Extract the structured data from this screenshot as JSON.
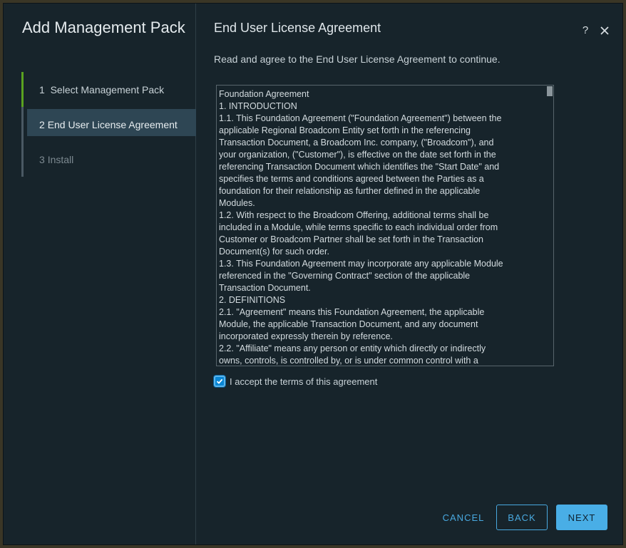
{
  "sidebar": {
    "title": "Add Management Pack",
    "steps": [
      {
        "number": "1",
        "label": "Select Management Pack",
        "state": "done"
      },
      {
        "number": "2",
        "label": "End User License Agreement",
        "state": "active"
      },
      {
        "number": "3",
        "label": "Install",
        "state": "pending"
      }
    ]
  },
  "header": {
    "title": "End User License Agreement",
    "help_icon": "?",
    "close_icon": "close-icon"
  },
  "intro": "Read and agree to the End User License Agreement to continue.",
  "eula": {
    "lines": [
      "Foundation Agreement",
      "1. INTRODUCTION",
      "1.1. This Foundation Agreement (\"Foundation Agreement\") between the",
      "applicable Regional Broadcom Entity set forth in the referencing",
      "Transaction Document, a Broadcom Inc. company, (\"Broadcom\"), and",
      "your organization, (\"Customer\"), is effective on the date set forth in the",
      "referencing Transaction Document which identifies the \"Start Date\" and",
      "specifies the terms and conditions agreed between the Parties as a",
      "foundation for their relationship as further defined in the applicable",
      "Modules.",
      "1.2. With respect to the Broadcom Offering, additional terms shall be",
      "included in a Module, while terms specific to each individual order from",
      "Customer or Broadcom Partner shall be set forth in the Transaction",
      "Document(s) for such order.",
      "1.3. This Foundation Agreement may incorporate any applicable Module",
      "referenced in the \"Governing Contract\" section of the applicable",
      "Transaction Document.",
      "2. DEFINITIONS",
      "2.1. \"Agreement\" means this Foundation Agreement, the applicable",
      "Module, the applicable Transaction Document, and any document",
      "incorporated expressly therein by reference.",
      "2.2. \"Affiliate\" means any person or entity which directly or indirectly",
      "owns, controls, is controlled by, or is under common control with a"
    ]
  },
  "accept": {
    "label": "I accept the terms of this agreement",
    "checked": true
  },
  "footer": {
    "cancel_label": "CANCEL",
    "back_label": "BACK",
    "next_label": "NEXT"
  },
  "colors": {
    "accent": "#49aee6",
    "step_done": "#5aa220",
    "dialog_bg": "#17242b"
  }
}
